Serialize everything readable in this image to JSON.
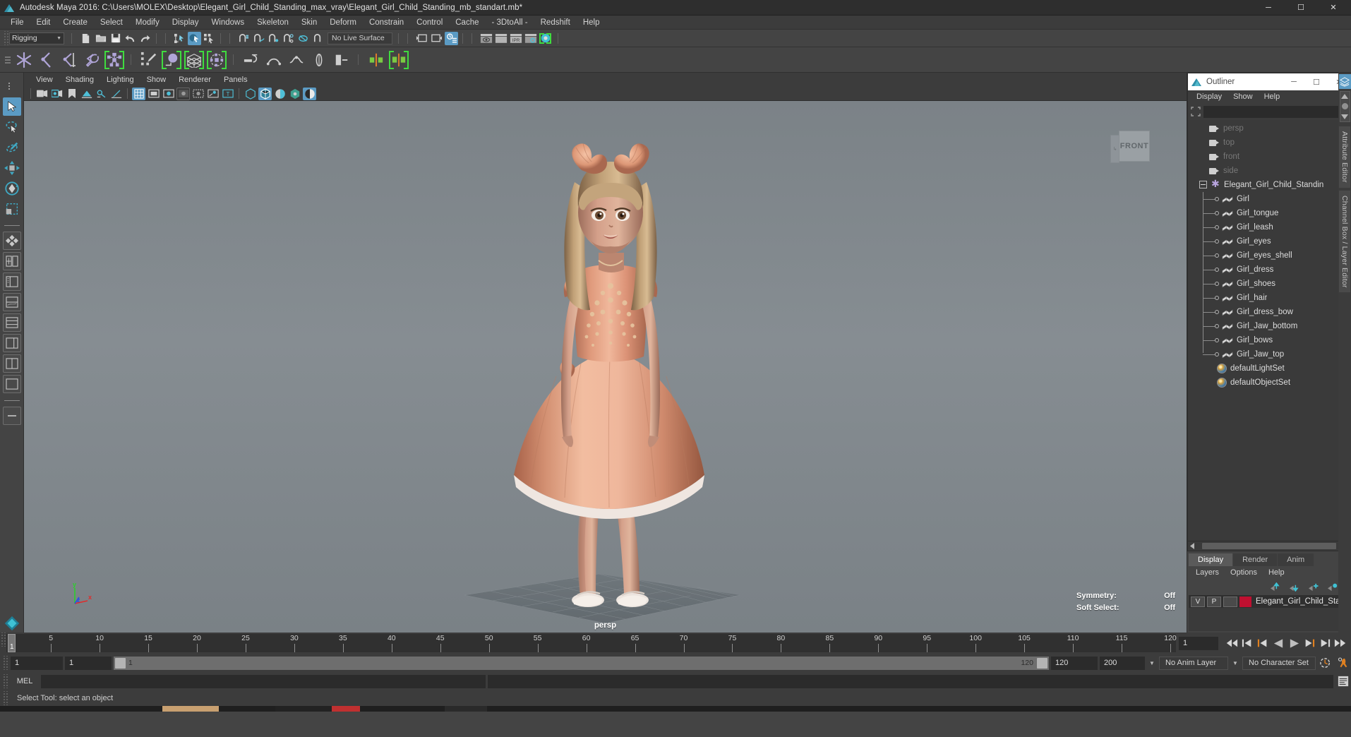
{
  "window": {
    "title": "Autodesk Maya 2016: C:\\Users\\MOLEX\\Desktop\\Elegant_Girl_Child_Standing_max_vray\\Elegant_Girl_Child_Standing_mb_standart.mb*",
    "minimize": "─",
    "maximize": "☐",
    "close": "✕"
  },
  "menubar": {
    "items": [
      "File",
      "Edit",
      "Create",
      "Select",
      "Modify",
      "Display",
      "Windows",
      "Skeleton",
      "Skin",
      "Deform",
      "Constrain",
      "Control",
      "Cache",
      "- 3DtoAll -",
      "Redshift",
      "Help"
    ]
  },
  "statusline": {
    "menuset": "Rigging",
    "menuset_arrow": "▼",
    "live_surface": "No Live Surface"
  },
  "panel_menu": {
    "items": [
      "View",
      "Shading",
      "Lighting",
      "Show",
      "Renderer",
      "Panels"
    ]
  },
  "viewport": {
    "camera_label": "persp",
    "viewcube_face": "FRONT",
    "viewcube_side": "↳",
    "axis": {
      "x": "x",
      "y": "y",
      "z": "z"
    },
    "hud": [
      {
        "label": "Symmetry:",
        "value": "Off"
      },
      {
        "label": "Soft Select:",
        "value": "Off"
      }
    ]
  },
  "outliner": {
    "title": "Outliner",
    "min": "─",
    "max": "☐",
    "close": "✕",
    "menu": [
      "Display",
      "Show",
      "Help"
    ],
    "search_value": "",
    "root_label": "Elegant_Girl_Child_Standin",
    "cameras": [
      "persp",
      "top",
      "front",
      "side"
    ],
    "children": [
      "Girl",
      "Girl_tongue",
      "Girl_leash",
      "Girl_eyes",
      "Girl_eyes_shell",
      "Girl_dress",
      "Girl_shoes",
      "Girl_hair",
      "Girl_dress_bow",
      "Girl_Jaw_bottom",
      "Girl_bows",
      "Girl_Jaw_top"
    ],
    "sets": [
      "defaultLightSet",
      "defaultObjectSet"
    ]
  },
  "layer_editor": {
    "tabs": [
      "Display",
      "Render",
      "Anim"
    ],
    "active_tab": "Display",
    "menu": [
      "Layers",
      "Options",
      "Help"
    ],
    "row": {
      "v": "V",
      "p": "P",
      "blank": "",
      "color": "#bf1030",
      "name": "Elegant_Girl_Child_Sta"
    }
  },
  "right_tabs": [
    "Attribute Editor",
    "Channel Box / Layer Editor"
  ],
  "timeline": {
    "start": 1,
    "end": 120,
    "current": "1",
    "ticks": [
      5,
      10,
      15,
      20,
      25,
      30,
      35,
      40,
      45,
      50,
      55,
      60,
      65,
      70,
      75,
      80,
      85,
      90,
      95,
      100,
      105,
      110,
      115,
      120
    ],
    "cursor_label": "1",
    "playback_buttons": [
      "go-to-start",
      "step-back-key",
      "step-back-frame",
      "play-backwards",
      "play-forwards",
      "step-forward-frame",
      "step-forward-key",
      "go-to-end"
    ]
  },
  "range": {
    "anim_start": "1",
    "anim_current_start": "1",
    "slider_label": "1",
    "slider_right_label": "120",
    "playback_end": "120",
    "anim_end": "200",
    "anim_layer": "No Anim Layer",
    "character_set": "No Character Set"
  },
  "command_line": {
    "label": "MEL",
    "value": "",
    "placeholder": ""
  },
  "help_line": {
    "text": "Select Tool: select an object"
  },
  "colors": {
    "accent_blue": "#5b9bc4",
    "shelf_green": "#3fdc3f",
    "teal": "#4fb6c9",
    "orange": "#e08020",
    "layer_red": "#bf1030"
  }
}
